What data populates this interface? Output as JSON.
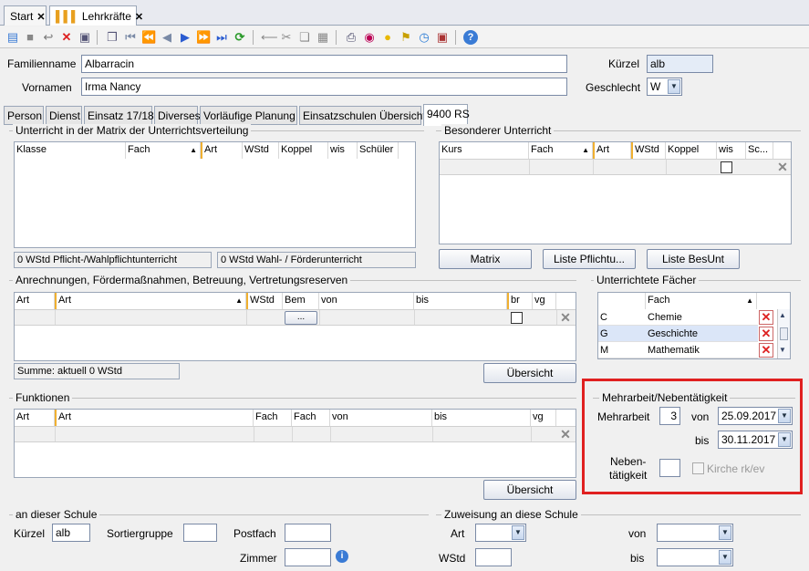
{
  "doc_tabs": [
    {
      "label": "Start"
    },
    {
      "label": "Lehrkräfte"
    }
  ],
  "toolbar_icons": [
    "new-icon",
    "save-icon",
    "undo-icon",
    "delete-icon",
    "print-preview-icon",
    "copy-icon",
    "first-icon",
    "prev-page-icon",
    "prev-icon",
    "next-icon",
    "next-page-icon",
    "last-icon",
    "refresh-icon",
    "back-icon",
    "cut-icon",
    "copy-doc-icon",
    "paste-icon",
    "print-icon",
    "view-icon",
    "bulb-icon",
    "broom-icon",
    "clock-icon",
    "report-icon",
    "help-icon"
  ],
  "fields": {
    "familienname_label": "Familienname",
    "familienname": "Albarracin",
    "vornamen_label": "Vornamen",
    "vornamen": "Irma Nancy",
    "kuerzel_label": "Kürzel",
    "kuerzel": "alb",
    "geschlecht_label": "Geschlecht",
    "geschlecht": "W"
  },
  "tabs": [
    "Person",
    "Dienst",
    "Einsatz 17/18",
    "Diverses",
    "Vorläufige Planung",
    "Einsatzschulen Übersicht",
    "9400 RS"
  ],
  "matrix": {
    "title": "Unterricht in der Matrix der Unterrichtsverteilung",
    "columns": [
      "Klasse",
      "Fach",
      "Art",
      "WStd",
      "Koppel",
      "wis",
      "Schüler"
    ],
    "status1": "0 WStd Pflicht-/Wahlpflichtunterricht",
    "status2": "0 WStd Wahl- / Förderunterricht"
  },
  "besonderer": {
    "title": "Besonderer Unterricht",
    "columns": [
      "Kurs",
      "Fach",
      "Art",
      "WStd",
      "Koppel",
      "wis",
      "Sc..."
    ],
    "buttons": [
      "Matrix",
      "Liste Pflichtu...",
      "Liste BesUnt"
    ]
  },
  "anrechnungen": {
    "title": "Anrechnungen, Fördermaßnahmen, Betreuung, Vertretungsreserven",
    "columns": [
      "Art",
      "Art",
      "WStd",
      "Bem",
      "von",
      "bis",
      "br",
      "vg"
    ],
    "ellipsis": "...",
    "summe": "Summe: aktuell 0 WStd",
    "button": "Übersicht"
  },
  "faecher": {
    "title": "Unterrichtete Fächer",
    "header": "Fach",
    "rows": [
      {
        "code": "C",
        "name": "Chemie"
      },
      {
        "code": "G",
        "name": "Geschichte"
      },
      {
        "code": "M",
        "name": "Mathematik"
      }
    ]
  },
  "funktionen": {
    "title": "Funktionen",
    "columns": [
      "Art",
      "Art",
      "Fach",
      "Fach",
      "von",
      "bis",
      "vg"
    ],
    "button": "Übersicht"
  },
  "mehrarbeit": {
    "title": "Mehrarbeit/Nebentätigkeit",
    "mehrarbeit_label": "Mehrarbeit",
    "mehrarbeit_value": "3",
    "von_label": "von",
    "von_value": "25.09.2017",
    "bis_label": "bis",
    "bis_value": "30.11.2017",
    "neben_label1": "Neben-",
    "neben_label2": "tätigkeit",
    "kirche_label": "Kirche rk/ev"
  },
  "schule": {
    "title": "an dieser Schule",
    "kuerzel_label": "Kürzel",
    "kuerzel": "alb",
    "sortier_label": "Sortiergruppe",
    "postfach_label": "Postfach",
    "zimmer_label": "Zimmer"
  },
  "zuweisung": {
    "title": "Zuweisung an diese Schule",
    "art_label": "Art",
    "wstd_label": "WStd",
    "von_label": "von",
    "bis_label": "bis"
  }
}
